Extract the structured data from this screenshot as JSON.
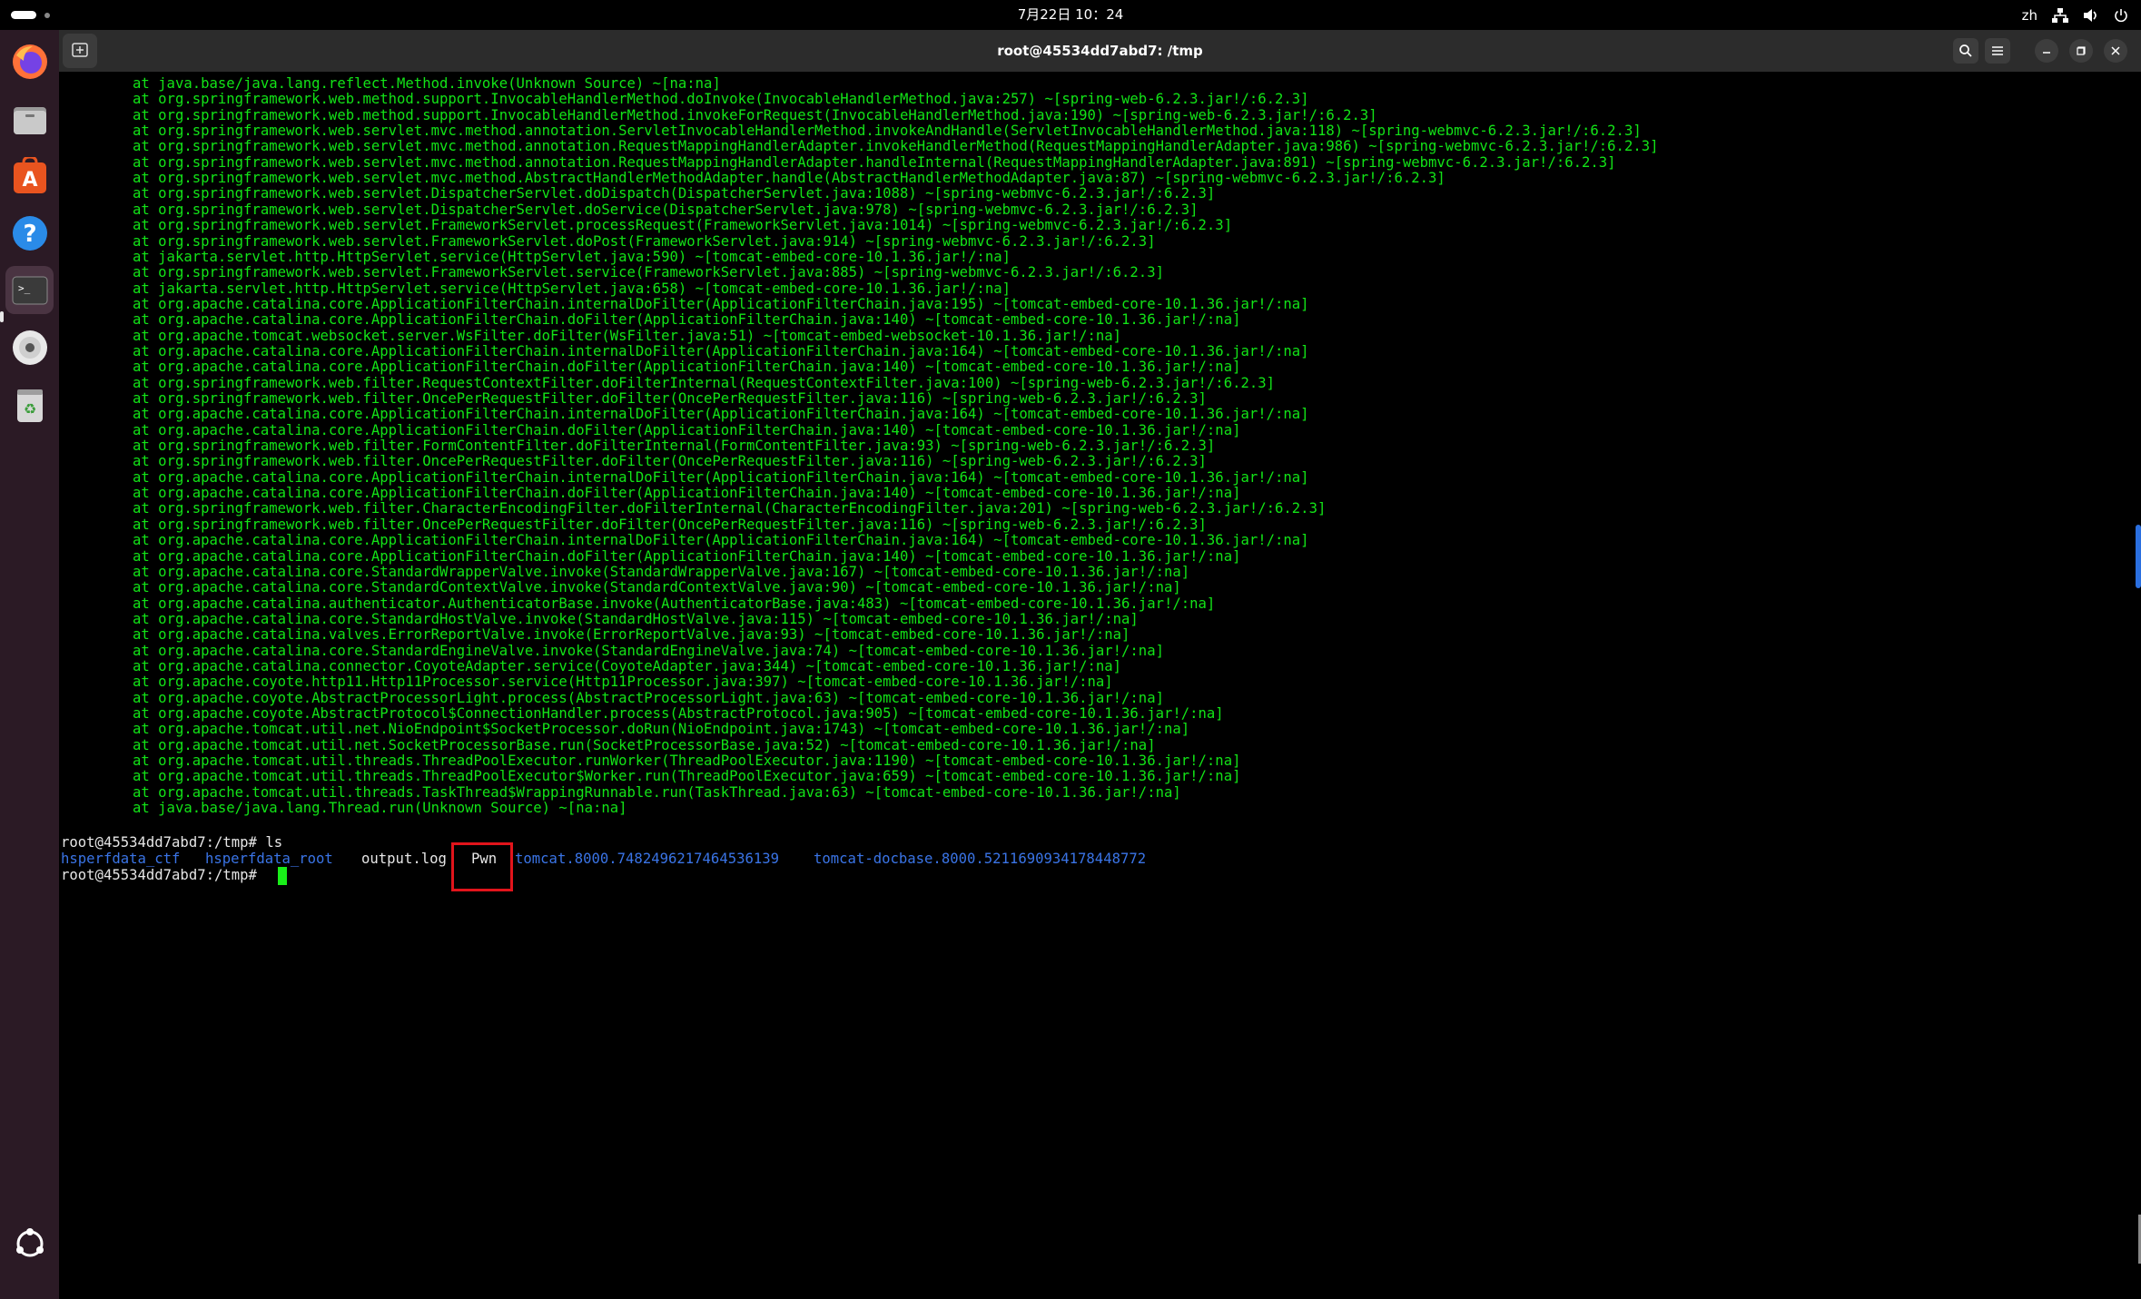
{
  "topbar": {
    "clock": "7月22日 10：24",
    "input_method": "zh"
  },
  "window": {
    "title": "root@45534dd7abd7: /tmp"
  },
  "terminal": {
    "trace_lines": [
      "at java.base/java.lang.reflect.Method.invoke(Unknown Source) ~[na:na]",
      "at org.springframework.web.method.support.InvocableHandlerMethod.doInvoke(InvocableHandlerMethod.java:257) ~[spring-web-6.2.3.jar!/:6.2.3]",
      "at org.springframework.web.method.support.InvocableHandlerMethod.invokeForRequest(InvocableHandlerMethod.java:190) ~[spring-web-6.2.3.jar!/:6.2.3]",
      "at org.springframework.web.servlet.mvc.method.annotation.ServletInvocableHandlerMethod.invokeAndHandle(ServletInvocableHandlerMethod.java:118) ~[spring-webmvc-6.2.3.jar!/:6.2.3]",
      "at org.springframework.web.servlet.mvc.method.annotation.RequestMappingHandlerAdapter.invokeHandlerMethod(RequestMappingHandlerAdapter.java:986) ~[spring-webmvc-6.2.3.jar!/:6.2.3]",
      "at org.springframework.web.servlet.mvc.method.annotation.RequestMappingHandlerAdapter.handleInternal(RequestMappingHandlerAdapter.java:891) ~[spring-webmvc-6.2.3.jar!/:6.2.3]",
      "at org.springframework.web.servlet.mvc.method.AbstractHandlerMethodAdapter.handle(AbstractHandlerMethodAdapter.java:87) ~[spring-webmvc-6.2.3.jar!/:6.2.3]",
      "at org.springframework.web.servlet.DispatcherServlet.doDispatch(DispatcherServlet.java:1088) ~[spring-webmvc-6.2.3.jar!/:6.2.3]",
      "at org.springframework.web.servlet.DispatcherServlet.doService(DispatcherServlet.java:978) ~[spring-webmvc-6.2.3.jar!/:6.2.3]",
      "at org.springframework.web.servlet.FrameworkServlet.processRequest(FrameworkServlet.java:1014) ~[spring-webmvc-6.2.3.jar!/:6.2.3]",
      "at org.springframework.web.servlet.FrameworkServlet.doPost(FrameworkServlet.java:914) ~[spring-webmvc-6.2.3.jar!/:6.2.3]",
      "at jakarta.servlet.http.HttpServlet.service(HttpServlet.java:590) ~[tomcat-embed-core-10.1.36.jar!/:na]",
      "at org.springframework.web.servlet.FrameworkServlet.service(FrameworkServlet.java:885) ~[spring-webmvc-6.2.3.jar!/:6.2.3]",
      "at jakarta.servlet.http.HttpServlet.service(HttpServlet.java:658) ~[tomcat-embed-core-10.1.36.jar!/:na]",
      "at org.apache.catalina.core.ApplicationFilterChain.internalDoFilter(ApplicationFilterChain.java:195) ~[tomcat-embed-core-10.1.36.jar!/:na]",
      "at org.apache.catalina.core.ApplicationFilterChain.doFilter(ApplicationFilterChain.java:140) ~[tomcat-embed-core-10.1.36.jar!/:na]",
      "at org.apache.tomcat.websocket.server.WsFilter.doFilter(WsFilter.java:51) ~[tomcat-embed-websocket-10.1.36.jar!/:na]",
      "at org.apache.catalina.core.ApplicationFilterChain.internalDoFilter(ApplicationFilterChain.java:164) ~[tomcat-embed-core-10.1.36.jar!/:na]",
      "at org.apache.catalina.core.ApplicationFilterChain.doFilter(ApplicationFilterChain.java:140) ~[tomcat-embed-core-10.1.36.jar!/:na]",
      "at org.springframework.web.filter.RequestContextFilter.doFilterInternal(RequestContextFilter.java:100) ~[spring-web-6.2.3.jar!/:6.2.3]",
      "at org.springframework.web.filter.OncePerRequestFilter.doFilter(OncePerRequestFilter.java:116) ~[spring-web-6.2.3.jar!/:6.2.3]",
      "at org.apache.catalina.core.ApplicationFilterChain.internalDoFilter(ApplicationFilterChain.java:164) ~[tomcat-embed-core-10.1.36.jar!/:na]",
      "at org.apache.catalina.core.ApplicationFilterChain.doFilter(ApplicationFilterChain.java:140) ~[tomcat-embed-core-10.1.36.jar!/:na]",
      "at org.springframework.web.filter.FormContentFilter.doFilterInternal(FormContentFilter.java:93) ~[spring-web-6.2.3.jar!/:6.2.3]",
      "at org.springframework.web.filter.OncePerRequestFilter.doFilter(OncePerRequestFilter.java:116) ~[spring-web-6.2.3.jar!/:6.2.3]",
      "at org.apache.catalina.core.ApplicationFilterChain.internalDoFilter(ApplicationFilterChain.java:164) ~[tomcat-embed-core-10.1.36.jar!/:na]",
      "at org.apache.catalina.core.ApplicationFilterChain.doFilter(ApplicationFilterChain.java:140) ~[tomcat-embed-core-10.1.36.jar!/:na]",
      "at org.springframework.web.filter.CharacterEncodingFilter.doFilterInternal(CharacterEncodingFilter.java:201) ~[spring-web-6.2.3.jar!/:6.2.3]",
      "at org.springframework.web.filter.OncePerRequestFilter.doFilter(OncePerRequestFilter.java:116) ~[spring-web-6.2.3.jar!/:6.2.3]",
      "at org.apache.catalina.core.ApplicationFilterChain.internalDoFilter(ApplicationFilterChain.java:164) ~[tomcat-embed-core-10.1.36.jar!/:na]",
      "at org.apache.catalina.core.ApplicationFilterChain.doFilter(ApplicationFilterChain.java:140) ~[tomcat-embed-core-10.1.36.jar!/:na]",
      "at org.apache.catalina.core.StandardWrapperValve.invoke(StandardWrapperValve.java:167) ~[tomcat-embed-core-10.1.36.jar!/:na]",
      "at org.apache.catalina.core.StandardContextValve.invoke(StandardContextValve.java:90) ~[tomcat-embed-core-10.1.36.jar!/:na]",
      "at org.apache.catalina.authenticator.AuthenticatorBase.invoke(AuthenticatorBase.java:483) ~[tomcat-embed-core-10.1.36.jar!/:na]",
      "at org.apache.catalina.core.StandardHostValve.invoke(StandardHostValve.java:115) ~[tomcat-embed-core-10.1.36.jar!/:na]",
      "at org.apache.catalina.valves.ErrorReportValve.invoke(ErrorReportValve.java:93) ~[tomcat-embed-core-10.1.36.jar!/:na]",
      "at org.apache.catalina.core.StandardEngineValve.invoke(StandardEngineValve.java:74) ~[tomcat-embed-core-10.1.36.jar!/:na]",
      "at org.apache.catalina.connector.CoyoteAdapter.service(CoyoteAdapter.java:344) ~[tomcat-embed-core-10.1.36.jar!/:na]",
      "at org.apache.coyote.http11.Http11Processor.service(Http11Processor.java:397) ~[tomcat-embed-core-10.1.36.jar!/:na]",
      "at org.apache.coyote.AbstractProcessorLight.process(AbstractProcessorLight.java:63) ~[tomcat-embed-core-10.1.36.jar!/:na]",
      "at org.apache.coyote.AbstractProtocol$ConnectionHandler.process(AbstractProtocol.java:905) ~[tomcat-embed-core-10.1.36.jar!/:na]",
      "at org.apache.tomcat.util.net.NioEndpoint$SocketProcessor.doRun(NioEndpoint.java:1743) ~[tomcat-embed-core-10.1.36.jar!/:na]",
      "at org.apache.tomcat.util.net.SocketProcessorBase.run(SocketProcessorBase.java:52) ~[tomcat-embed-core-10.1.36.jar!/:na]",
      "at org.apache.tomcat.util.threads.ThreadPoolExecutor.runWorker(ThreadPoolExecutor.java:1190) ~[tomcat-embed-core-10.1.36.jar!/:na]",
      "at org.apache.tomcat.util.threads.ThreadPoolExecutor$Worker.run(ThreadPoolExecutor.java:659) ~[tomcat-embed-core-10.1.36.jar!/:na]",
      "at org.apache.tomcat.util.threads.TaskThread$WrappingRunnable.run(TaskThread.java:63) ~[tomcat-embed-core-10.1.36.jar!/:na]",
      "at java.base/java.lang.Thread.run(Unknown Source) ~[na:na]"
    ],
    "prompt_ls": "root@45534dd7abd7:/tmp# ls",
    "ls_output": {
      "dir1": "hsperfdata_ctf",
      "dir2": "hsperfdata_root",
      "file1": "output.log",
      "file2": "Pwn",
      "dir3": "tomcat.8000.7482496217464536139",
      "dir4": "tomcat-docbase.8000.5211690934178448772"
    },
    "prompt_current": "root@45534dd7abd7:/tmp#"
  },
  "colors": {
    "trace_text": "#12e317",
    "directory": "#3a74e6",
    "highlight_box": "#e1141b",
    "headerbar": "#2c2c2c",
    "dock": "#2b1a25"
  },
  "icons": {
    "dock": [
      "firefox-icon",
      "files-icon",
      "app-center-icon",
      "help-icon",
      "terminal-icon",
      "disc-icon",
      "trash-icon",
      "show-apps-icon"
    ],
    "header": [
      "new-tab-icon",
      "search-icon",
      "menu-icon",
      "minimize-icon",
      "maximize-icon",
      "close-icon"
    ],
    "tray": [
      "network-icon",
      "volume-icon",
      "power-icon"
    ]
  }
}
